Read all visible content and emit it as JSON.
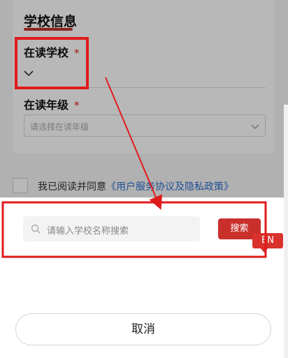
{
  "form": {
    "section_title": "学校信息",
    "school_label": "在读学校",
    "school_required": "*",
    "grade_label": "在读年级",
    "grade_required": "*",
    "grade_placeholder": "请选择在读年级"
  },
  "agreement": {
    "text": "我已阅读并同意",
    "link": "《用户服务协议及隐私政策》"
  },
  "sheet": {
    "search_placeholder": "请输入学校名称搜索",
    "search_button": "搜索",
    "en_badge": "EN",
    "cancel_button": "取消"
  },
  "colors": {
    "accent": "#c9302c",
    "link": "#2f6ecf",
    "annotation": "#e01b1b"
  },
  "icons": {
    "school_dropdown": "chevron-down-icon",
    "grade_dropdown": "chevron-down-icon",
    "search": "search-icon"
  }
}
